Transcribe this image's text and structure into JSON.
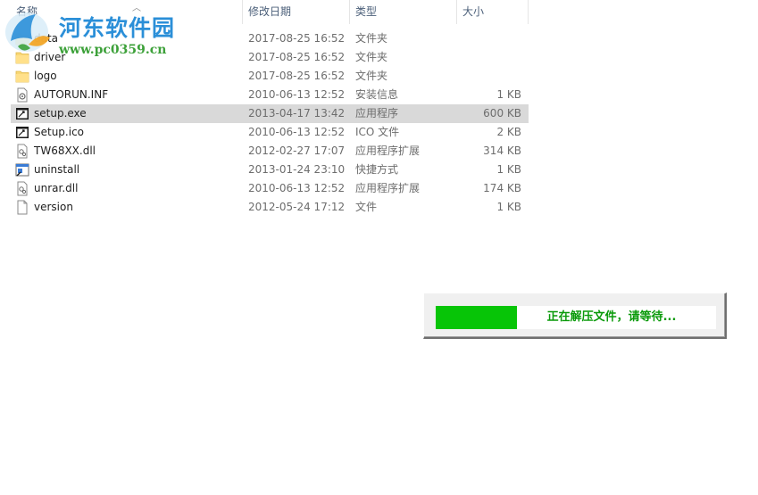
{
  "columns": {
    "name": "名称",
    "date": "修改日期",
    "type": "类型",
    "size": "大小"
  },
  "watermark": {
    "title": "河东软件园",
    "url": "www.pc0359.cn"
  },
  "files": [
    {
      "name": "data",
      "date": "2017-08-25 16:52",
      "type": "文件夹",
      "size": "",
      "icon": "folder-icon"
    },
    {
      "name": "driver",
      "date": "2017-08-25 16:52",
      "type": "文件夹",
      "size": "",
      "icon": "folder-icon"
    },
    {
      "name": "logo",
      "date": "2017-08-25 16:52",
      "type": "文件夹",
      "size": "",
      "icon": "folder-icon"
    },
    {
      "name": "AUTORUN.INF",
      "date": "2010-06-13 12:52",
      "type": "安装信息",
      "size": "1 KB",
      "icon": "settings-file-icon"
    },
    {
      "name": "setup.exe",
      "date": "2013-04-17 13:42",
      "type": "应用程序",
      "size": "600 KB",
      "icon": "application-icon",
      "selected": true
    },
    {
      "name": "Setup.ico",
      "date": "2010-06-13 12:52",
      "type": "ICO 文件",
      "size": "2 KB",
      "icon": "ico-file-icon"
    },
    {
      "name": "TW68XX.dll",
      "date": "2012-02-27 17:07",
      "type": "应用程序扩展",
      "size": "314 KB",
      "icon": "dll-file-icon"
    },
    {
      "name": "uninstall",
      "date": "2013-01-24 23:10",
      "type": "快捷方式",
      "size": "1 KB",
      "icon": "shortcut-icon"
    },
    {
      "name": "unrar.dll",
      "date": "2010-06-13 12:52",
      "type": "应用程序扩展",
      "size": "174 KB",
      "icon": "dll-file-icon"
    },
    {
      "name": "version",
      "date": "2012-05-24 17:12",
      "type": "文件",
      "size": "1 KB",
      "icon": "blank-file-icon"
    }
  ],
  "progress": {
    "label": "正在解压文件，请等待...",
    "fraction": 0.29,
    "fill_color": "#07c507"
  }
}
